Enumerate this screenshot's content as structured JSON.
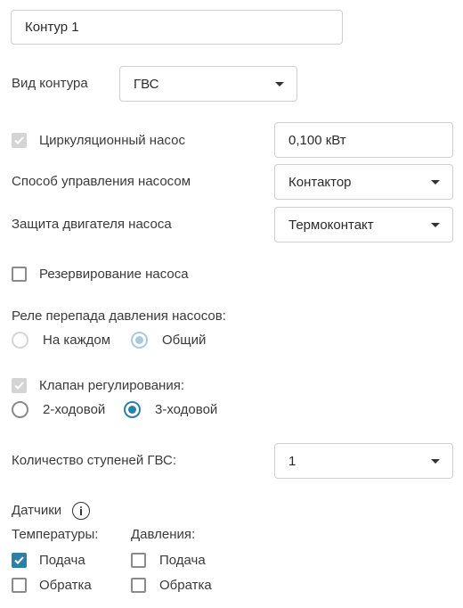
{
  "contour_name": {
    "value": "Контур 1"
  },
  "contour_type": {
    "label": "Вид контура",
    "value": "ГВС"
  },
  "circ_pump": {
    "label": "Циркуляционный насос",
    "power_value": "0,100 кВт",
    "checked": true,
    "disabled": true
  },
  "pump_control": {
    "label": "Способ управления насосом",
    "value": "Контактор"
  },
  "motor_protection": {
    "label": "Защита двигателя насоса",
    "value": "Термоконтакт"
  },
  "pump_reserve": {
    "label": "Резервирование насоса",
    "checked": false
  },
  "pressure_relay": {
    "label": "Реле перепада давления насосов:",
    "options": [
      "На каждом",
      "Общий"
    ],
    "selected": "Общий"
  },
  "control_valve": {
    "label": "Клапан регулирования:",
    "checked": true,
    "disabled": true,
    "options": [
      "2-ходовой",
      "3-ходовой"
    ],
    "selected": "3-ходовой"
  },
  "dhw_stages": {
    "label": "Количество ступеней ГВС:",
    "value": "1"
  },
  "sensors": {
    "title": "Датчики",
    "temperature": {
      "title": "Температуры:",
      "supply": "Подача",
      "return": "Обратка",
      "supply_checked": true,
      "return_checked": false
    },
    "pressure": {
      "title": "Давления:",
      "supply": "Подача",
      "return": "Обратка",
      "supply_checked": false,
      "return_checked": false
    }
  },
  "colors": {
    "accent": "#2e7fa8",
    "border": "#cfcfcf",
    "disabled": "#d4d4d4"
  }
}
